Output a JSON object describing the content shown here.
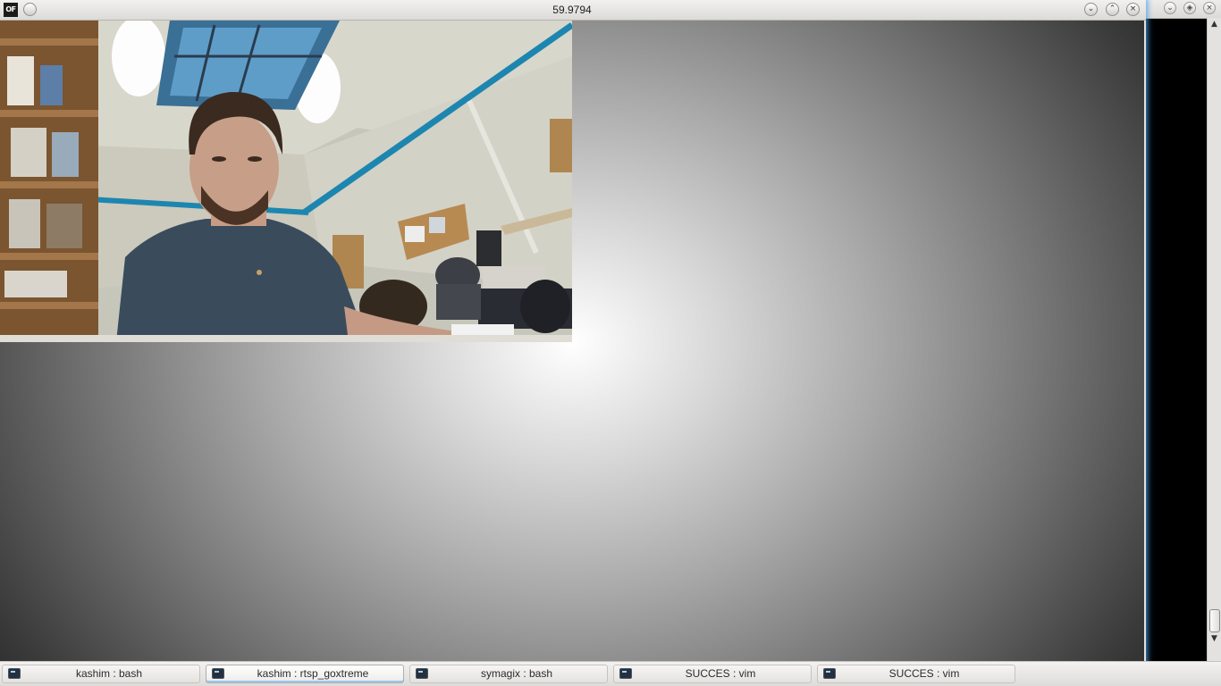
{
  "window": {
    "title": "59.9794",
    "app_icon_text": "OF"
  },
  "canvas": {
    "video_feed_description": "webcam frame"
  },
  "taskbar": {
    "tasks": [
      {
        "label": "kashim : bash",
        "active": false
      },
      {
        "label": "kashim : rtsp_goxtreme",
        "active": true
      },
      {
        "label": "symagix : bash",
        "active": false
      },
      {
        "label": "SUCCES : vim",
        "active": false
      },
      {
        "label": "SUCCES : vim",
        "active": false
      }
    ]
  },
  "colors": {
    "window_glow": "#46a0e6",
    "pipe_blue": "#1d86b0",
    "shirt": "#3a4b5c"
  },
  "icons": {
    "app": "openframeworks-icon",
    "window_menu": "circle-menu-icon",
    "minimize": "chevron-down-icon",
    "maximize": "chevron-up-icon",
    "close": "close-icon",
    "terminal": "terminal-icon"
  }
}
